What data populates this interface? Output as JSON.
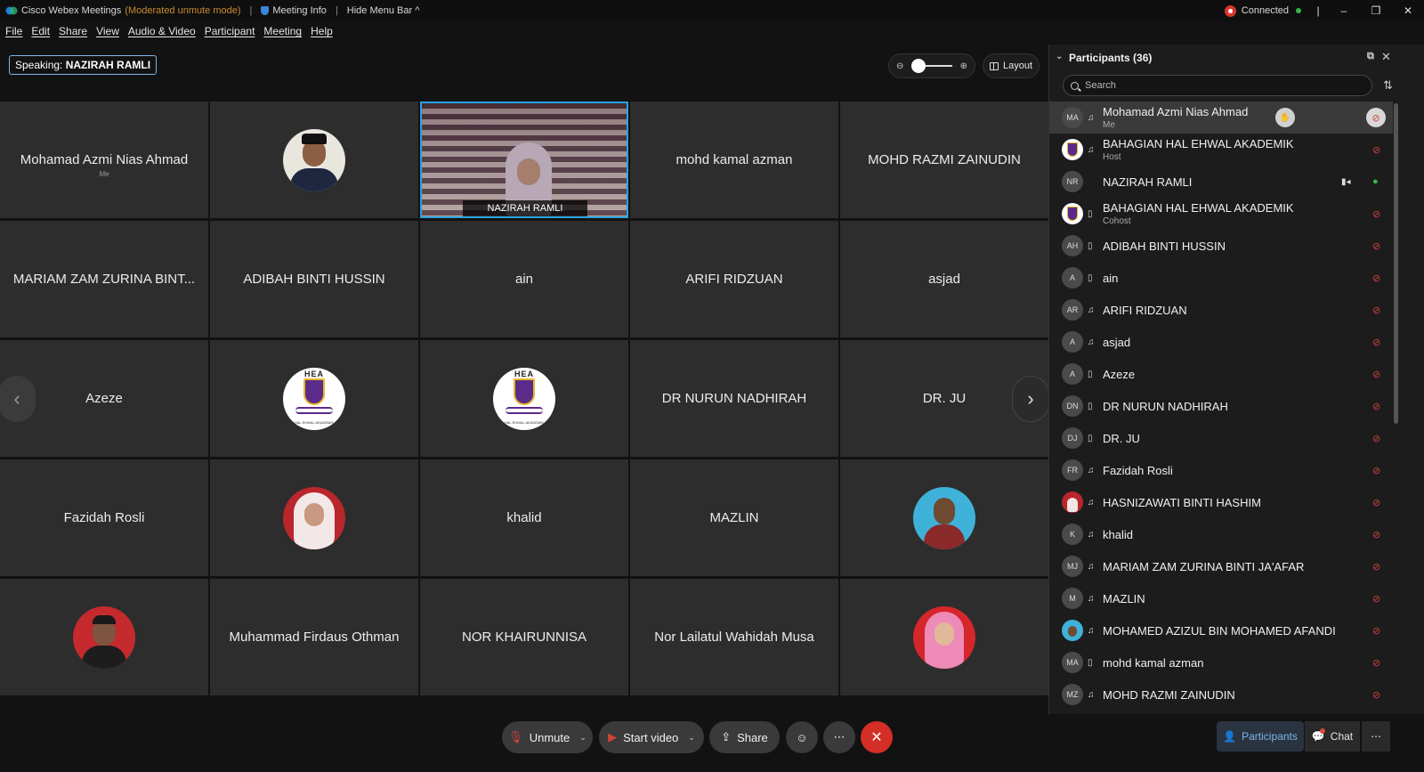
{
  "titlebar": {
    "app": "Cisco Webex Meetings",
    "mode": "(Moderated unmute mode)",
    "meeting_info": "Meeting Info",
    "hide_menu": "Hide Menu Bar ^",
    "status": "Connected"
  },
  "menu": [
    "File",
    "Edit",
    "Share",
    "View",
    "Audio & Video",
    "Participant",
    "Meeting",
    "Help"
  ],
  "speaking": {
    "label": "Speaking:",
    "name": "NAZIRAH RAMLI"
  },
  "layout_button": "Layout",
  "tiles": [
    {
      "name": "Mohamad Azmi Nias Ahmad",
      "sub": "Me"
    },
    {
      "avatar": "photo-man"
    },
    {
      "video": true,
      "name": "NAZIRAH RAMLI"
    },
    {
      "name": "mohd kamal azman"
    },
    {
      "name": "MOHD RAZMI ZAINUDIN"
    },
    {
      "name": "MARIAM ZAM ZURINA BINT..."
    },
    {
      "name": "ADIBAH BINTI HUSSIN"
    },
    {
      "name": "ain"
    },
    {
      "name": "ARIFI RIDZUAN"
    },
    {
      "name": "asjad"
    },
    {
      "name": "Azeze"
    },
    {
      "avatar": "hea-logo"
    },
    {
      "avatar": "hea-logo"
    },
    {
      "name": "DR NURUN NADHIRAH"
    },
    {
      "name": "DR. JU"
    },
    {
      "name": "Fazidah Rosli"
    },
    {
      "avatar": "photo-woman-red"
    },
    {
      "name": "khalid"
    },
    {
      "name": "MAZLIN"
    },
    {
      "avatar": "photo-man-blue"
    },
    {
      "avatar": "photo-man-red"
    },
    {
      "name": "Muhammad Firdaus Othman"
    },
    {
      "name": "NOR KHAIRUNNISA"
    },
    {
      "name": "Nor Lailatul Wahidah Musa"
    },
    {
      "avatar": "photo-woman-pink"
    }
  ],
  "logo": {
    "top": "HEA",
    "bottom": "HAL EHWAL AKADEMIK"
  },
  "panel": {
    "title": "Participants (36)",
    "search_placeholder": "Search",
    "participants": [
      {
        "initials": "MA",
        "name": "Mohamad Azmi Nias Ahmad",
        "role": "Me",
        "device": "headset",
        "mic": "muted",
        "me": true
      },
      {
        "avatar": "logo",
        "name": "BAHAGIAN HAL EHWAL AKADEMIK",
        "role": "Host",
        "device": "headset",
        "mic": "muted"
      },
      {
        "initials": "NR",
        "name": "NAZIRAH RAMLI",
        "device": "none",
        "mic": "on",
        "camera": true
      },
      {
        "avatar": "logo",
        "name": "BAHAGIAN HAL EHWAL AKADEMIK",
        "role": "Cohost",
        "device": "phone",
        "mic": "muted"
      },
      {
        "initials": "AH",
        "name": "ADIBAH BINTI HUSSIN",
        "device": "phone",
        "mic": "muted"
      },
      {
        "initials": "A",
        "name": "ain",
        "device": "phone",
        "mic": "muted"
      },
      {
        "initials": "AR",
        "name": "ARIFI RIDZUAN",
        "device": "headset",
        "mic": "muted"
      },
      {
        "initials": "A",
        "name": "asjad",
        "device": "headset",
        "mic": "muted"
      },
      {
        "initials": "A",
        "name": "Azeze",
        "device": "phone",
        "mic": "muted"
      },
      {
        "initials": "DN",
        "name": "DR NURUN NADHIRAH",
        "device": "phone",
        "mic": "muted"
      },
      {
        "initials": "DJ",
        "name": "DR. JU",
        "device": "phone",
        "mic": "muted"
      },
      {
        "initials": "FR",
        "name": "Fazidah Rosli",
        "device": "headset",
        "mic": "muted"
      },
      {
        "avatar": "red",
        "name": "HASNIZAWATI BINTI HASHIM",
        "device": "headset",
        "mic": "muted"
      },
      {
        "initials": "K",
        "name": "khalid",
        "device": "headset",
        "mic": "muted"
      },
      {
        "initials": "MJ",
        "name": "MARIAM ZAM ZURINA BINTI JA'AFAR",
        "device": "headset",
        "mic": "muted"
      },
      {
        "initials": "M",
        "name": "MAZLIN",
        "device": "headset",
        "mic": "muted"
      },
      {
        "avatar": "blue",
        "name": "MOHAMED AZIZUL BIN MOHAMED AFANDI",
        "device": "headset",
        "mic": "muted"
      },
      {
        "initials": "MA",
        "name": "mohd kamal azman",
        "device": "phone",
        "mic": "muted"
      },
      {
        "initials": "MZ",
        "name": "MOHD RAZMI ZAINUDIN",
        "device": "headset",
        "mic": "muted"
      }
    ]
  },
  "controls": {
    "unmute": "Unmute",
    "start_video": "Start video",
    "share": "Share",
    "participants": "Participants",
    "chat": "Chat"
  },
  "colors": {
    "accent": "#26a3e0",
    "leave": "#d32f26",
    "mute": "#d0433b",
    "ok": "#35b34a"
  }
}
